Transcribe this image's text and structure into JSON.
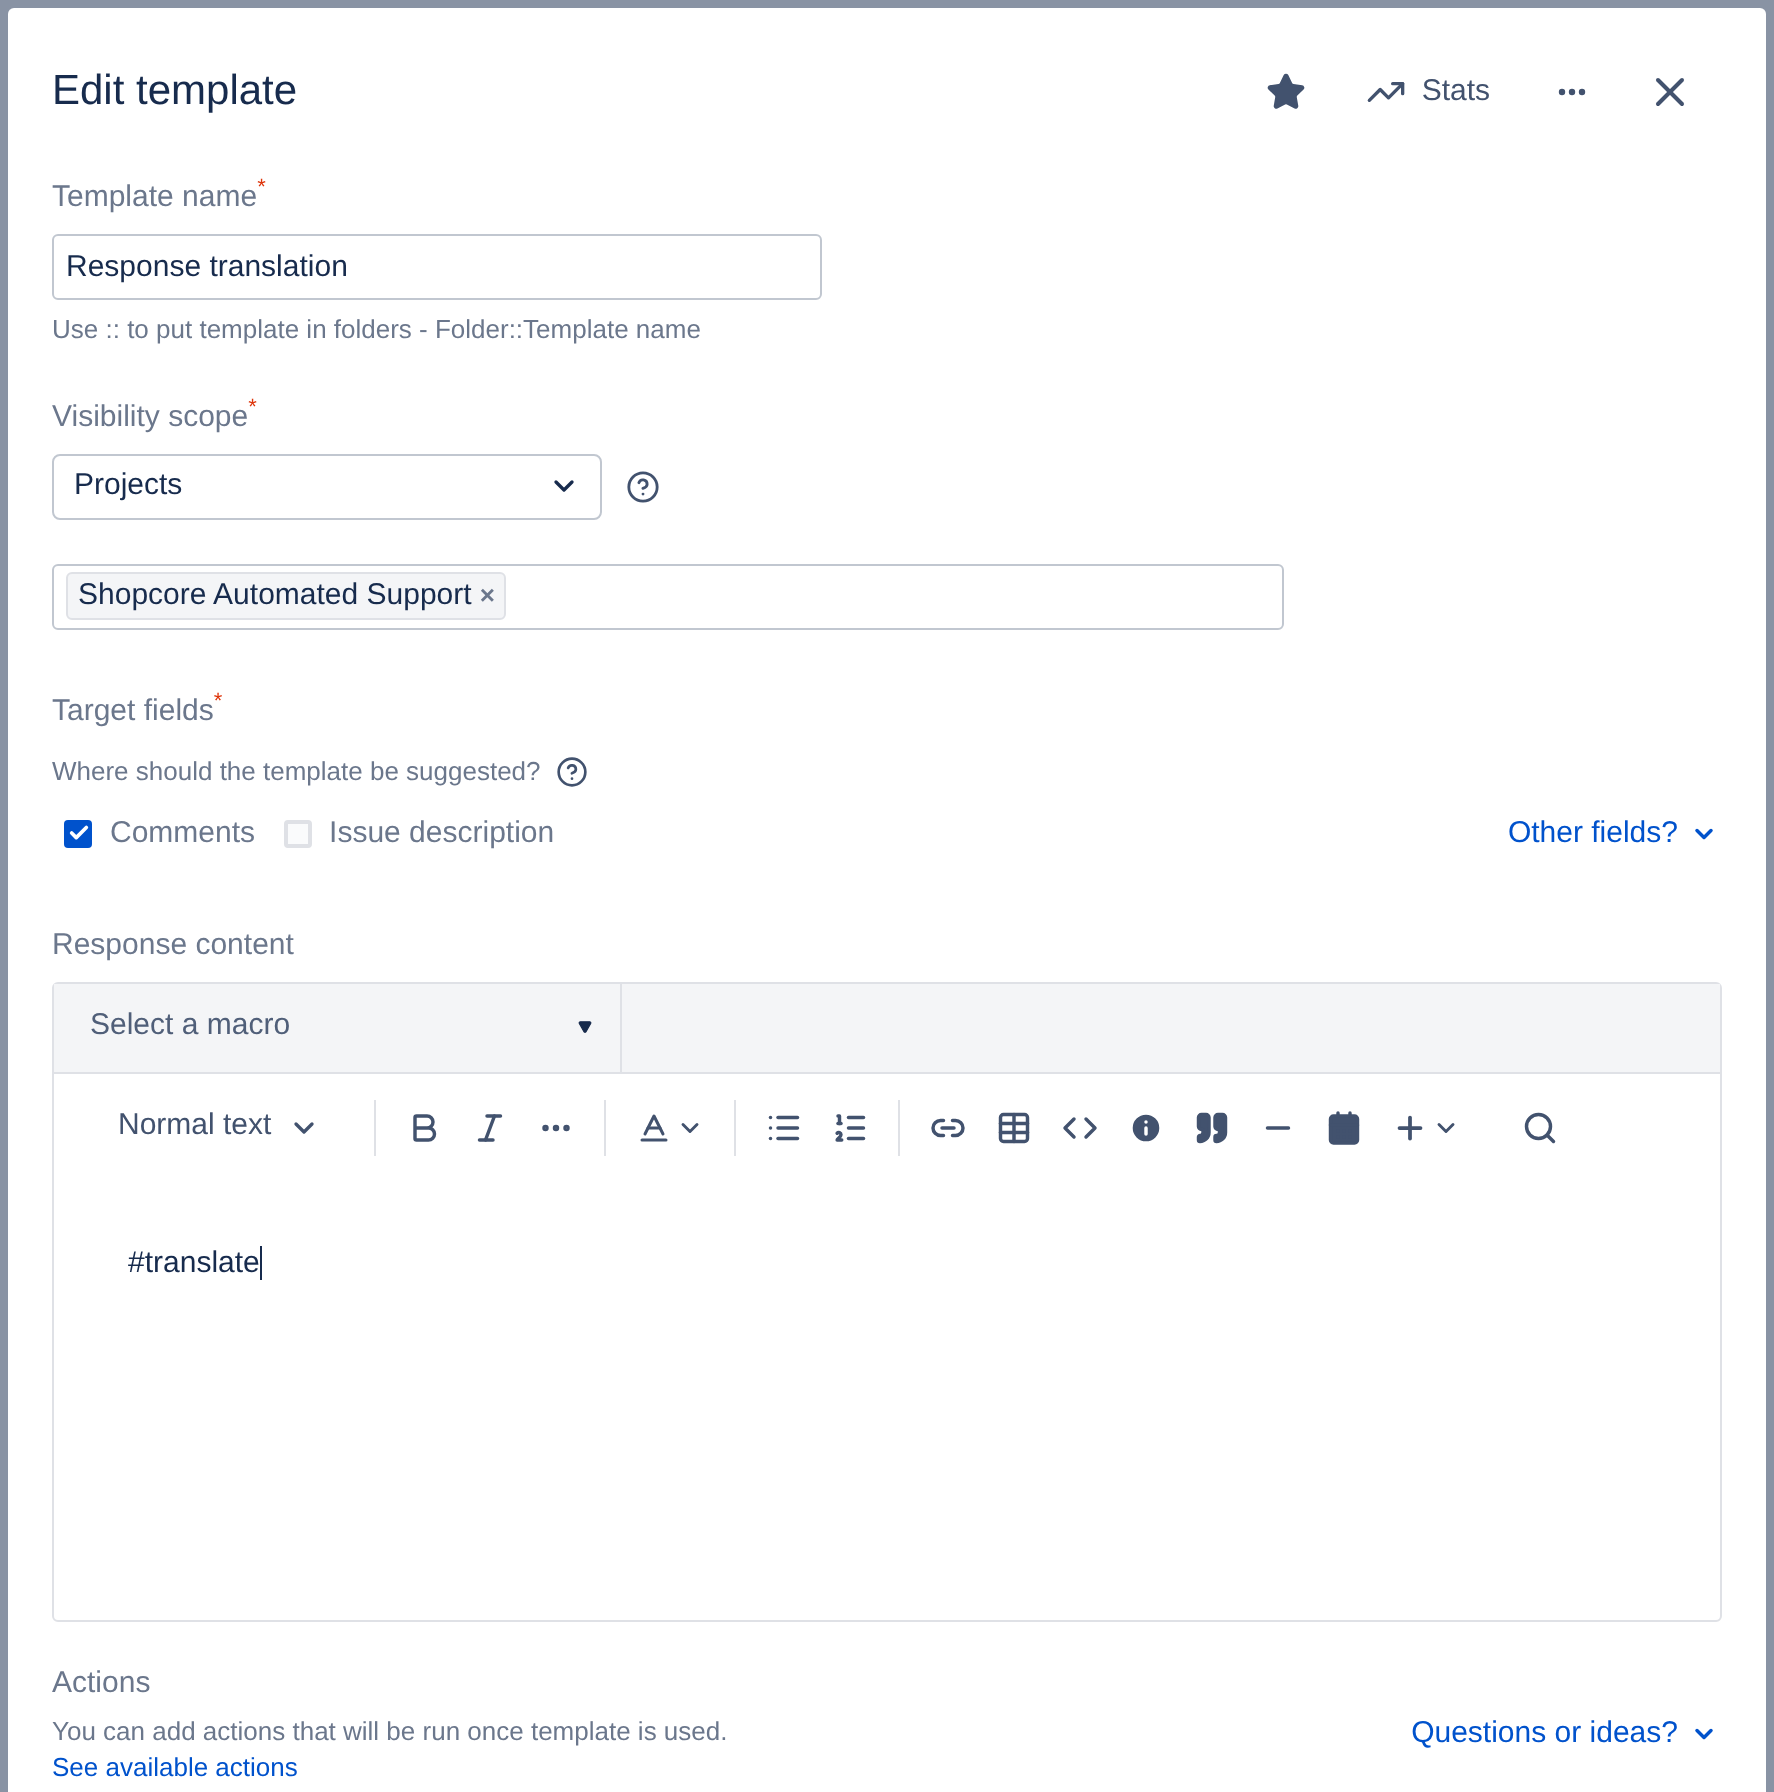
{
  "dialog": {
    "title": "Edit template",
    "header_actions": [
      {
        "kind": "star"
      },
      {
        "kind": "stats",
        "label": "Stats"
      },
      {
        "kind": "more"
      },
      {
        "kind": "close"
      }
    ]
  },
  "template_name": {
    "label": "Template name",
    "required_mark": "*",
    "value": "Response translation",
    "hint": "Use :: to put template in folders - Folder::Template name"
  },
  "visibility_scope": {
    "label": "Visibility scope",
    "required_mark": "*",
    "value": "Projects",
    "projects": [
      {
        "label": "Shopcore Automated Support",
        "remove": "×"
      }
    ]
  },
  "target_fields": {
    "label": "Target fields",
    "required_mark": "*",
    "question": "Where should the template be suggested?",
    "options": [
      {
        "label": "Comments",
        "checked": true
      },
      {
        "label": "Issue description",
        "checked": false
      }
    ],
    "other_link": "Other fields?"
  },
  "response_content": {
    "label": "Response content",
    "macro_select": "Select a macro",
    "text_style": "Normal text",
    "toolbar": [
      {
        "kind": "bold"
      },
      {
        "kind": "italic"
      },
      {
        "kind": "more"
      },
      {
        "kind": "sep"
      },
      {
        "kind": "color"
      },
      {
        "kind": "sep"
      },
      {
        "kind": "bullets"
      },
      {
        "kind": "numbers"
      },
      {
        "kind": "sep"
      },
      {
        "kind": "link"
      },
      {
        "kind": "table"
      },
      {
        "kind": "code"
      },
      {
        "kind": "info"
      },
      {
        "kind": "quote"
      },
      {
        "kind": "rule"
      },
      {
        "kind": "date"
      },
      {
        "kind": "insert"
      },
      {
        "kind": "search"
      }
    ],
    "body": "#translate"
  },
  "actions": {
    "label": "Actions",
    "description": "You can add actions that will be run once template is used.",
    "link": "See available actions",
    "feedback_link": "Questions or ideas?"
  }
}
